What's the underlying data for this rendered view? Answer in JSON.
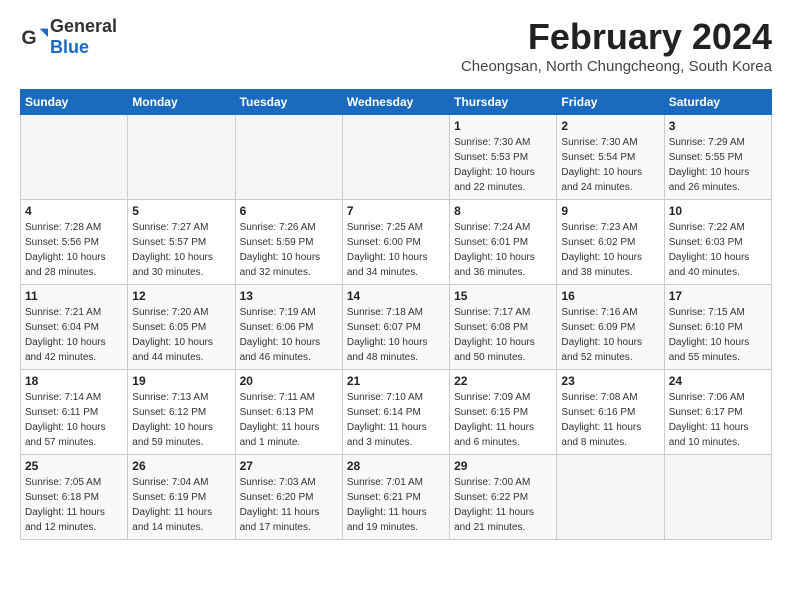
{
  "header": {
    "logo_general": "General",
    "logo_blue": "Blue",
    "month_title": "February 2024",
    "subtitle": "Cheongsan, North Chungcheong, South Korea"
  },
  "days_of_week": [
    "Sunday",
    "Monday",
    "Tuesday",
    "Wednesday",
    "Thursday",
    "Friday",
    "Saturday"
  ],
  "weeks": [
    [
      {
        "day": "",
        "info": ""
      },
      {
        "day": "",
        "info": ""
      },
      {
        "day": "",
        "info": ""
      },
      {
        "day": "",
        "info": ""
      },
      {
        "day": "1",
        "info": "Sunrise: 7:30 AM\nSunset: 5:53 PM\nDaylight: 10 hours\nand 22 minutes."
      },
      {
        "day": "2",
        "info": "Sunrise: 7:30 AM\nSunset: 5:54 PM\nDaylight: 10 hours\nand 24 minutes."
      },
      {
        "day": "3",
        "info": "Sunrise: 7:29 AM\nSunset: 5:55 PM\nDaylight: 10 hours\nand 26 minutes."
      }
    ],
    [
      {
        "day": "4",
        "info": "Sunrise: 7:28 AM\nSunset: 5:56 PM\nDaylight: 10 hours\nand 28 minutes."
      },
      {
        "day": "5",
        "info": "Sunrise: 7:27 AM\nSunset: 5:57 PM\nDaylight: 10 hours\nand 30 minutes."
      },
      {
        "day": "6",
        "info": "Sunrise: 7:26 AM\nSunset: 5:59 PM\nDaylight: 10 hours\nand 32 minutes."
      },
      {
        "day": "7",
        "info": "Sunrise: 7:25 AM\nSunset: 6:00 PM\nDaylight: 10 hours\nand 34 minutes."
      },
      {
        "day": "8",
        "info": "Sunrise: 7:24 AM\nSunset: 6:01 PM\nDaylight: 10 hours\nand 36 minutes."
      },
      {
        "day": "9",
        "info": "Sunrise: 7:23 AM\nSunset: 6:02 PM\nDaylight: 10 hours\nand 38 minutes."
      },
      {
        "day": "10",
        "info": "Sunrise: 7:22 AM\nSunset: 6:03 PM\nDaylight: 10 hours\nand 40 minutes."
      }
    ],
    [
      {
        "day": "11",
        "info": "Sunrise: 7:21 AM\nSunset: 6:04 PM\nDaylight: 10 hours\nand 42 minutes."
      },
      {
        "day": "12",
        "info": "Sunrise: 7:20 AM\nSunset: 6:05 PM\nDaylight: 10 hours\nand 44 minutes."
      },
      {
        "day": "13",
        "info": "Sunrise: 7:19 AM\nSunset: 6:06 PM\nDaylight: 10 hours\nand 46 minutes."
      },
      {
        "day": "14",
        "info": "Sunrise: 7:18 AM\nSunset: 6:07 PM\nDaylight: 10 hours\nand 48 minutes."
      },
      {
        "day": "15",
        "info": "Sunrise: 7:17 AM\nSunset: 6:08 PM\nDaylight: 10 hours\nand 50 minutes."
      },
      {
        "day": "16",
        "info": "Sunrise: 7:16 AM\nSunset: 6:09 PM\nDaylight: 10 hours\nand 52 minutes."
      },
      {
        "day": "17",
        "info": "Sunrise: 7:15 AM\nSunset: 6:10 PM\nDaylight: 10 hours\nand 55 minutes."
      }
    ],
    [
      {
        "day": "18",
        "info": "Sunrise: 7:14 AM\nSunset: 6:11 PM\nDaylight: 10 hours\nand 57 minutes."
      },
      {
        "day": "19",
        "info": "Sunrise: 7:13 AM\nSunset: 6:12 PM\nDaylight: 10 hours\nand 59 minutes."
      },
      {
        "day": "20",
        "info": "Sunrise: 7:11 AM\nSunset: 6:13 PM\nDaylight: 11 hours\nand 1 minute."
      },
      {
        "day": "21",
        "info": "Sunrise: 7:10 AM\nSunset: 6:14 PM\nDaylight: 11 hours\nand 3 minutes."
      },
      {
        "day": "22",
        "info": "Sunrise: 7:09 AM\nSunset: 6:15 PM\nDaylight: 11 hours\nand 6 minutes."
      },
      {
        "day": "23",
        "info": "Sunrise: 7:08 AM\nSunset: 6:16 PM\nDaylight: 11 hours\nand 8 minutes."
      },
      {
        "day": "24",
        "info": "Sunrise: 7:06 AM\nSunset: 6:17 PM\nDaylight: 11 hours\nand 10 minutes."
      }
    ],
    [
      {
        "day": "25",
        "info": "Sunrise: 7:05 AM\nSunset: 6:18 PM\nDaylight: 11 hours\nand 12 minutes."
      },
      {
        "day": "26",
        "info": "Sunrise: 7:04 AM\nSunset: 6:19 PM\nDaylight: 11 hours\nand 14 minutes."
      },
      {
        "day": "27",
        "info": "Sunrise: 7:03 AM\nSunset: 6:20 PM\nDaylight: 11 hours\nand 17 minutes."
      },
      {
        "day": "28",
        "info": "Sunrise: 7:01 AM\nSunset: 6:21 PM\nDaylight: 11 hours\nand 19 minutes."
      },
      {
        "day": "29",
        "info": "Sunrise: 7:00 AM\nSunset: 6:22 PM\nDaylight: 11 hours\nand 21 minutes."
      },
      {
        "day": "",
        "info": ""
      },
      {
        "day": "",
        "info": ""
      }
    ]
  ]
}
